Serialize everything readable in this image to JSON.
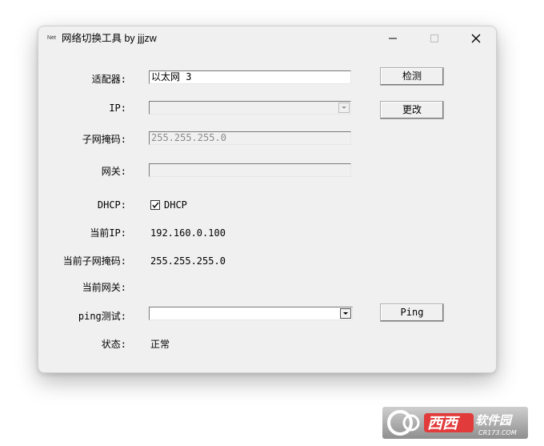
{
  "window": {
    "icon_text": "Net",
    "title": "网络切换工具 by jjjzw",
    "controls": [
      "minimize-icon",
      "maximize-icon",
      "close-icon"
    ]
  },
  "labels": {
    "adapter": "适配器:",
    "ip": "IP:",
    "subnet": "子网掩码:",
    "gateway": "网关:",
    "dhcp": "DHCP:",
    "current_ip": "当前IP:",
    "current_subnet": "当前子网掩码:",
    "current_gateway": "当前网关:",
    "ping": "ping测试:",
    "status": "状态:"
  },
  "fields": {
    "adapter_value": "以太网 3",
    "ip_value": "",
    "subnet_value": "255.255.255.0",
    "gateway_value": "",
    "dhcp_checked": true,
    "dhcp_label": "DHCP",
    "ping_value": ""
  },
  "values": {
    "current_ip": "192.160.0.100",
    "current_subnet": "255.255.255.0",
    "current_gateway": "",
    "status": "正常"
  },
  "buttons": {
    "detect": "检测",
    "change": "更改",
    "ping": "Ping"
  },
  "watermark": {
    "brand_text": "西西软件园",
    "domain_text": "CR173.COM"
  }
}
